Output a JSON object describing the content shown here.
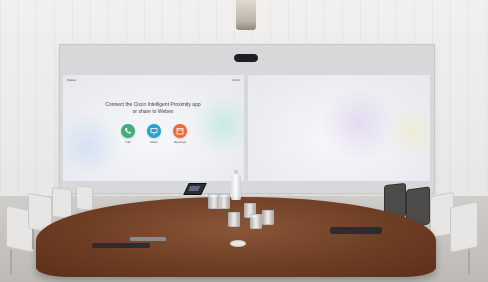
{
  "display": {
    "left_screen": {
      "label": "Webex",
      "clock": "09:41",
      "prompt_line_1": "Connect the Cisco Intelligent Proximity app",
      "prompt_line_2": "or share to Webex",
      "actions": [
        {
          "label": "Call",
          "icon": "phone-icon",
          "color": "#3fb07a"
        },
        {
          "label": "Share",
          "icon": "share-icon",
          "color": "#23a6c9"
        },
        {
          "label": "Meetings",
          "icon": "calendar-icon",
          "color": "#ef6a3a"
        }
      ]
    },
    "right_screen": {}
  },
  "colors": {
    "wall": "#ecebe9",
    "table": "#6e3e24",
    "display_frame": "#d7d8da"
  }
}
